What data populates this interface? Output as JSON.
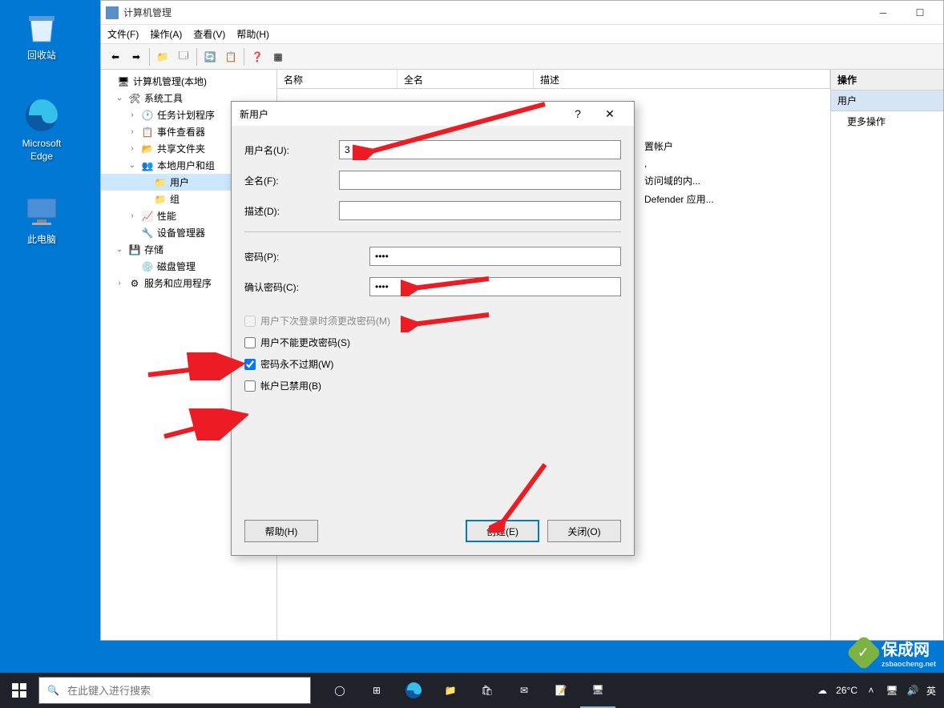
{
  "desktop_icons": [
    {
      "label": "回收站",
      "id": "recycle-bin"
    },
    {
      "label": "Microsoft Edge",
      "id": "edge"
    },
    {
      "label": "此电脑",
      "id": "this-pc"
    }
  ],
  "window": {
    "title": "计算机管理",
    "menus": [
      "文件(F)",
      "操作(A)",
      "查看(V)",
      "帮助(H)"
    ],
    "tree": {
      "root": "计算机管理(本地)",
      "sys_tools": "系统工具",
      "task_scheduler": "任务计划程序",
      "event_viewer": "事件查看器",
      "shared_folders": "共享文件夹",
      "local_users": "本地用户和组",
      "users": "用户",
      "groups": "组",
      "performance": "性能",
      "device_mgr": "设备管理器",
      "storage": "存储",
      "disk_mgmt": "磁盘管理",
      "services": "服务和应用程序"
    },
    "columns": {
      "name": "名称",
      "fullname": "全名",
      "desc": "描述"
    },
    "rows": [
      {
        "desc": "置帐户"
      },
      {
        "desc": ","
      },
      {
        "desc": "访问域的内..."
      },
      {
        "desc": "Defender 应用..."
      }
    ],
    "actions": {
      "header": "操作",
      "group": "用户",
      "more": "更多操作"
    }
  },
  "dialog": {
    "title": "新用户",
    "username_label": "用户名(U):",
    "username_value": "3",
    "fullname_label": "全名(F):",
    "fullname_value": "",
    "desc_label": "描述(D):",
    "desc_value": "",
    "password_label": "密码(P):",
    "password_value": "••••",
    "confirm_label": "确认密码(C):",
    "confirm_value": "••••",
    "chk_must_change": "用户下次登录时须更改密码(M)",
    "chk_cannot_change": "用户不能更改密码(S)",
    "chk_never_expire": "密码永不过期(W)",
    "chk_disabled": "帐户已禁用(B)",
    "btn_help": "帮助(H)",
    "btn_create": "创建(E)",
    "btn_close": "关闭(O)"
  },
  "taskbar": {
    "search_placeholder": "在此键入进行搜索",
    "weather": "26°C",
    "ime": "英"
  },
  "watermark": {
    "main": "保成网",
    "sub": "zsbaocheng.net"
  }
}
